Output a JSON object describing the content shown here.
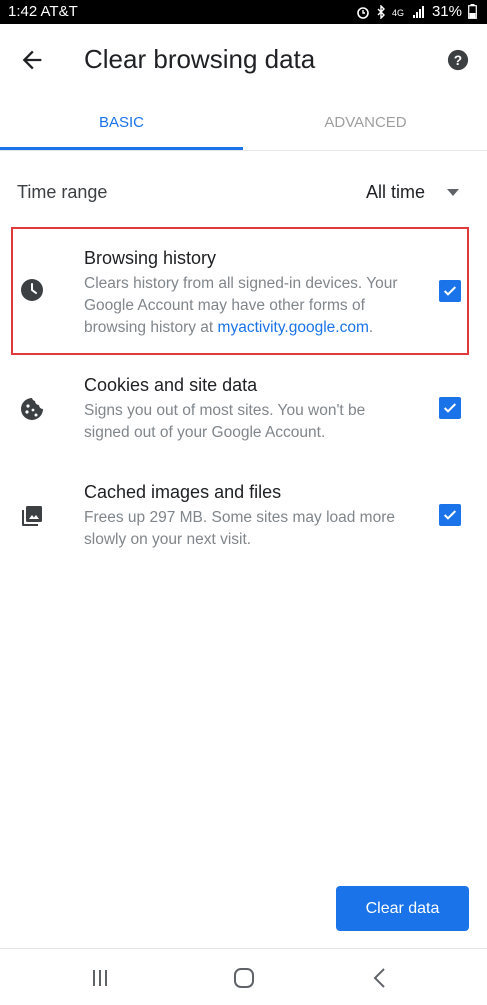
{
  "status_bar": {
    "time_carrier": "1:42 AT&T",
    "battery": "31%",
    "icons": [
      "alarm-icon",
      "bluetooth-icon",
      "4g-icon",
      "signal-icon",
      "battery-icon"
    ]
  },
  "app_bar": {
    "title": "Clear browsing data",
    "back_icon": "arrow-left-icon",
    "help_icon": "help-circle-icon"
  },
  "tabs": [
    {
      "label": "BASIC",
      "selected": true
    },
    {
      "label": "ADVANCED",
      "selected": false
    }
  ],
  "time_range": {
    "label": "Time range",
    "value": "All time"
  },
  "items": [
    {
      "icon": "clock-icon",
      "title": "Browsing history",
      "description": "Clears history from all signed-in devices. Your Google Account may have other forms of browsing history at ",
      "link": "myactivity.google.com",
      "description_end": ".",
      "checked": true
    },
    {
      "icon": "cookie-icon",
      "title": "Cookies and site data",
      "description": "Signs you out of most sites. You won't be signed out of your Google Account.",
      "checked": true
    },
    {
      "icon": "images-icon",
      "title": "Cached images and files",
      "description": "Frees up 297 MB. Some sites may load more slowly on your next visit.",
      "checked": true
    }
  ],
  "actions": {
    "clear_label": "Clear data"
  },
  "colors": {
    "accent": "#1a73e8",
    "highlight": "#e0393e"
  }
}
